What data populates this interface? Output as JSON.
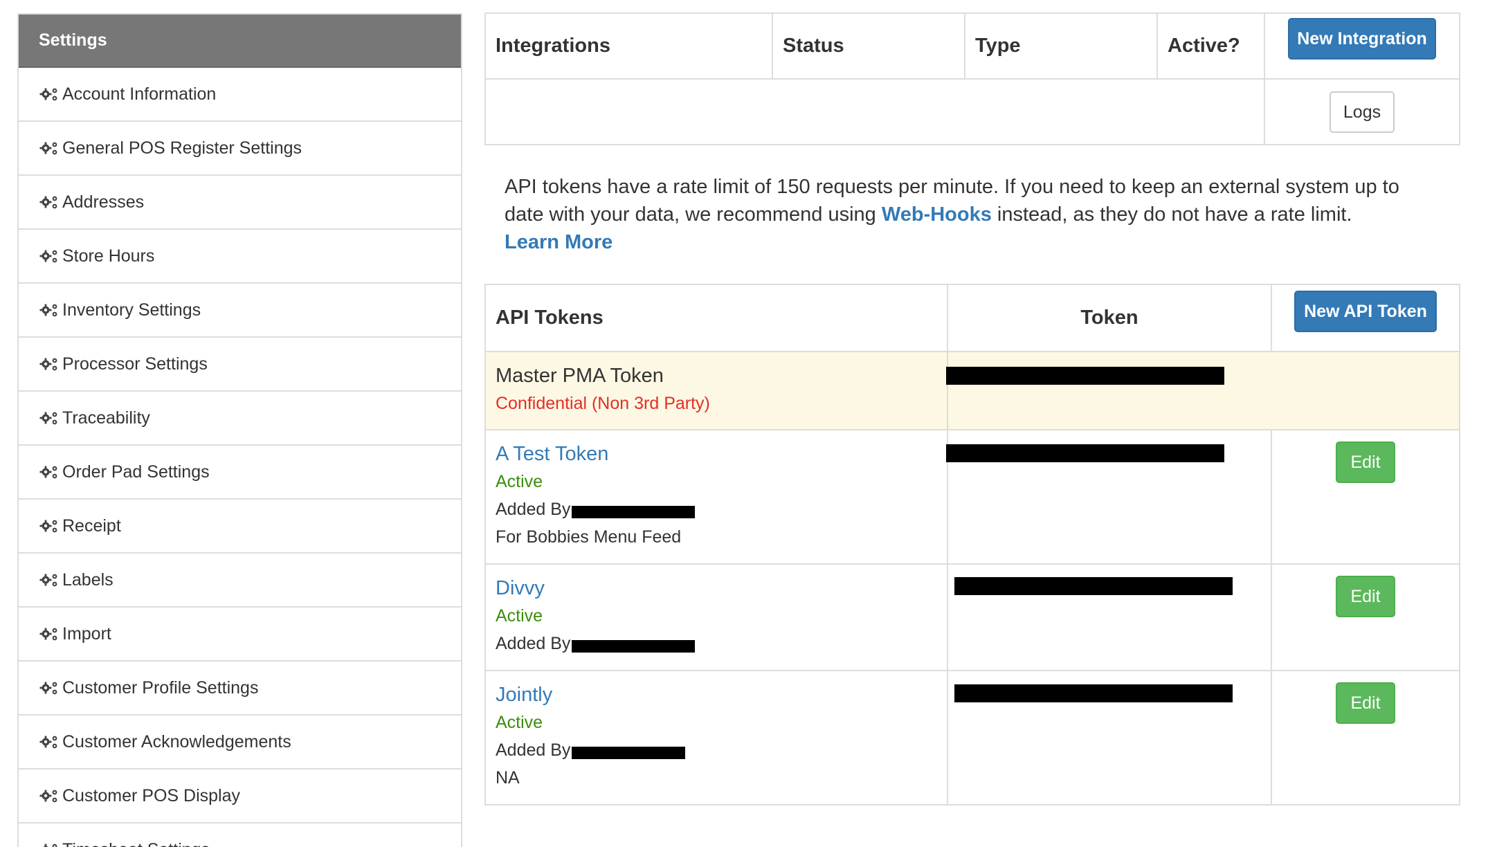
{
  "sidebar": {
    "title": "Settings",
    "items": [
      {
        "label": "Account Information",
        "icon": "gears-icon"
      },
      {
        "label": "General POS Register Settings",
        "icon": "gears-icon"
      },
      {
        "label": "Addresses",
        "icon": "gears-icon"
      },
      {
        "label": "Store Hours",
        "icon": "gears-icon"
      },
      {
        "label": "Inventory Settings",
        "icon": "gears-icon"
      },
      {
        "label": "Processor Settings",
        "icon": "gears-icon"
      },
      {
        "label": "Traceability",
        "icon": "gears-icon"
      },
      {
        "label": "Order Pad Settings",
        "icon": "gears-icon"
      },
      {
        "label": "Receipt",
        "icon": "gears-icon"
      },
      {
        "label": "Labels",
        "icon": "gears-icon"
      },
      {
        "label": "Import",
        "icon": "gears-icon"
      },
      {
        "label": "Customer Profile Settings",
        "icon": "gears-icon"
      },
      {
        "label": "Customer Acknowledgements",
        "icon": "gears-icon"
      },
      {
        "label": "Customer POS Display",
        "icon": "gears-icon"
      },
      {
        "label": "Timesheet Settings",
        "icon": "gears-icon"
      }
    ]
  },
  "integrations": {
    "headers": [
      "Integrations",
      "Status",
      "Type",
      "Active?"
    ],
    "new_button": "New Integration",
    "logs_button": "Logs"
  },
  "notice": {
    "text_before": "API tokens have a rate limit of 150 requests per minute. If you need to keep an external system up to date with your data, we recommend using ",
    "link": "Web-Hooks",
    "text_after": " instead, as they do not have a rate limit.",
    "learn_more": "Learn More"
  },
  "api_tokens": {
    "header": "API Tokens",
    "token_header": "Token",
    "new_button": "New API Token",
    "master": {
      "name": "Master PMA Token",
      "note": "Confidential (Non 3rd Party)"
    },
    "rows": [
      {
        "name": "A Test Token",
        "status": "Active",
        "added_by": "Added By",
        "description": "For Bobbies Menu Feed",
        "edit": "Edit"
      },
      {
        "name": "Divvy",
        "status": "Active",
        "added_by": "Added By",
        "description": "",
        "edit": "Edit"
      },
      {
        "name": "Jointly",
        "status": "Active",
        "added_by": "Added By",
        "description": "NA",
        "edit": "Edit"
      }
    ]
  },
  "colors": {
    "primary": "#337ab7",
    "success": "#5cb85c",
    "active_text": "#3c8d0d",
    "confidential_text": "#e52d27",
    "master_row_bg": "#fcf8e3",
    "sidebar_header_bg": "#777777"
  }
}
